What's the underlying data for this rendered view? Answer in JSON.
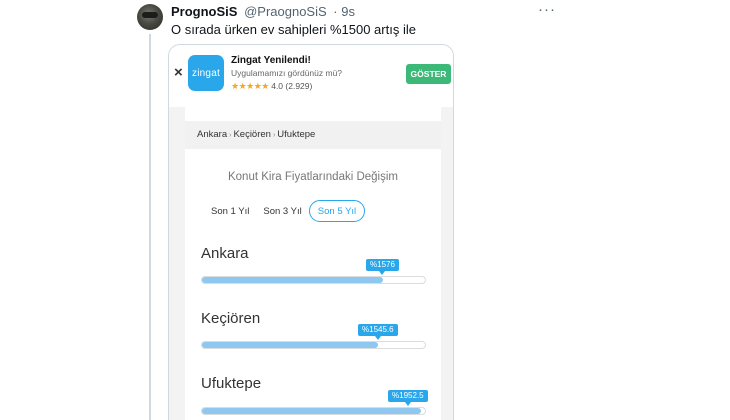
{
  "tweet": {
    "author_name": "PrognoSiS",
    "author_handle": "@PraognoSiS",
    "time": "· 9s",
    "more_icon": "more-icon",
    "text": "O sırada ürken ev sahipleri %1500 artış ile"
  },
  "app_banner": {
    "close": "×",
    "icon_text": "zingat",
    "title": "Zingat Yenilendi!",
    "subtitle": "Uygulamamızı gördünüz mü?",
    "stars": "★★★★★",
    "rating": "4.0 (2.929)",
    "button_label": "GÖSTER",
    "accent_color": "#2aa6ea",
    "button_color": "#3cb878"
  },
  "breadcrumb": [
    "Ankara",
    "Keçiören",
    "Ufuktepe"
  ],
  "section_title": "Konut Kira Fiyatlarındaki Değişim",
  "tabs": [
    {
      "label": "Son 1 Yıl",
      "active": false
    },
    {
      "label": "Son 3 Yıl",
      "active": false
    },
    {
      "label": "Son 5 Yıl",
      "active": true
    }
  ],
  "locations": [
    {
      "name": "Ankara",
      "change": "%1576",
      "fill": 0.81
    },
    {
      "name": "Keçiören",
      "change": "%1545.6",
      "fill": 0.79
    },
    {
      "name": "Ufuktepe",
      "change": "%1952.5",
      "fill": 0.98
    }
  ]
}
